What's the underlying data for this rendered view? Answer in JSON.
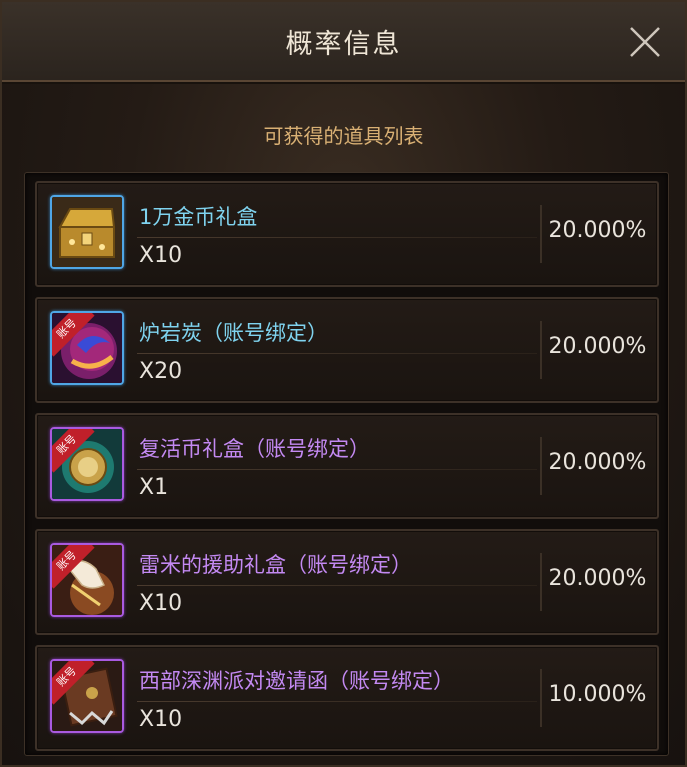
{
  "window": {
    "title": "概率信息"
  },
  "subtitle": "可获得的道具列表",
  "items": [
    {
      "name": "1万金币礼盒",
      "quantity": "X10",
      "rate": "20.000%",
      "rarity": "blue",
      "icon": "gold-chest-icon"
    },
    {
      "name": "炉岩炭（账号绑定）",
      "quantity": "X20",
      "rate": "20.000%",
      "rarity": "blue",
      "icon": "lava-orb-icon",
      "badge": "账号"
    },
    {
      "name": "复活币礼盒（账号绑定）",
      "quantity": "X1",
      "rate": "20.000%",
      "rarity": "purple",
      "icon": "revive-coin-icon",
      "badge": "账号"
    },
    {
      "name": "雷米的援助礼盒（账号绑定）",
      "quantity": "X10",
      "rate": "20.000%",
      "rarity": "purple",
      "icon": "glove-box-icon",
      "badge": "账号"
    },
    {
      "name": "西部深渊派对邀请函（账号绑定）",
      "quantity": "X10",
      "rate": "10.000%",
      "rarity": "purple",
      "icon": "invitation-icon",
      "badge": "账号"
    }
  ],
  "colors": {
    "blue_rarity": "#4fa6e6",
    "purple_rarity": "#a95ae0",
    "subtitle": "#d9b074"
  }
}
